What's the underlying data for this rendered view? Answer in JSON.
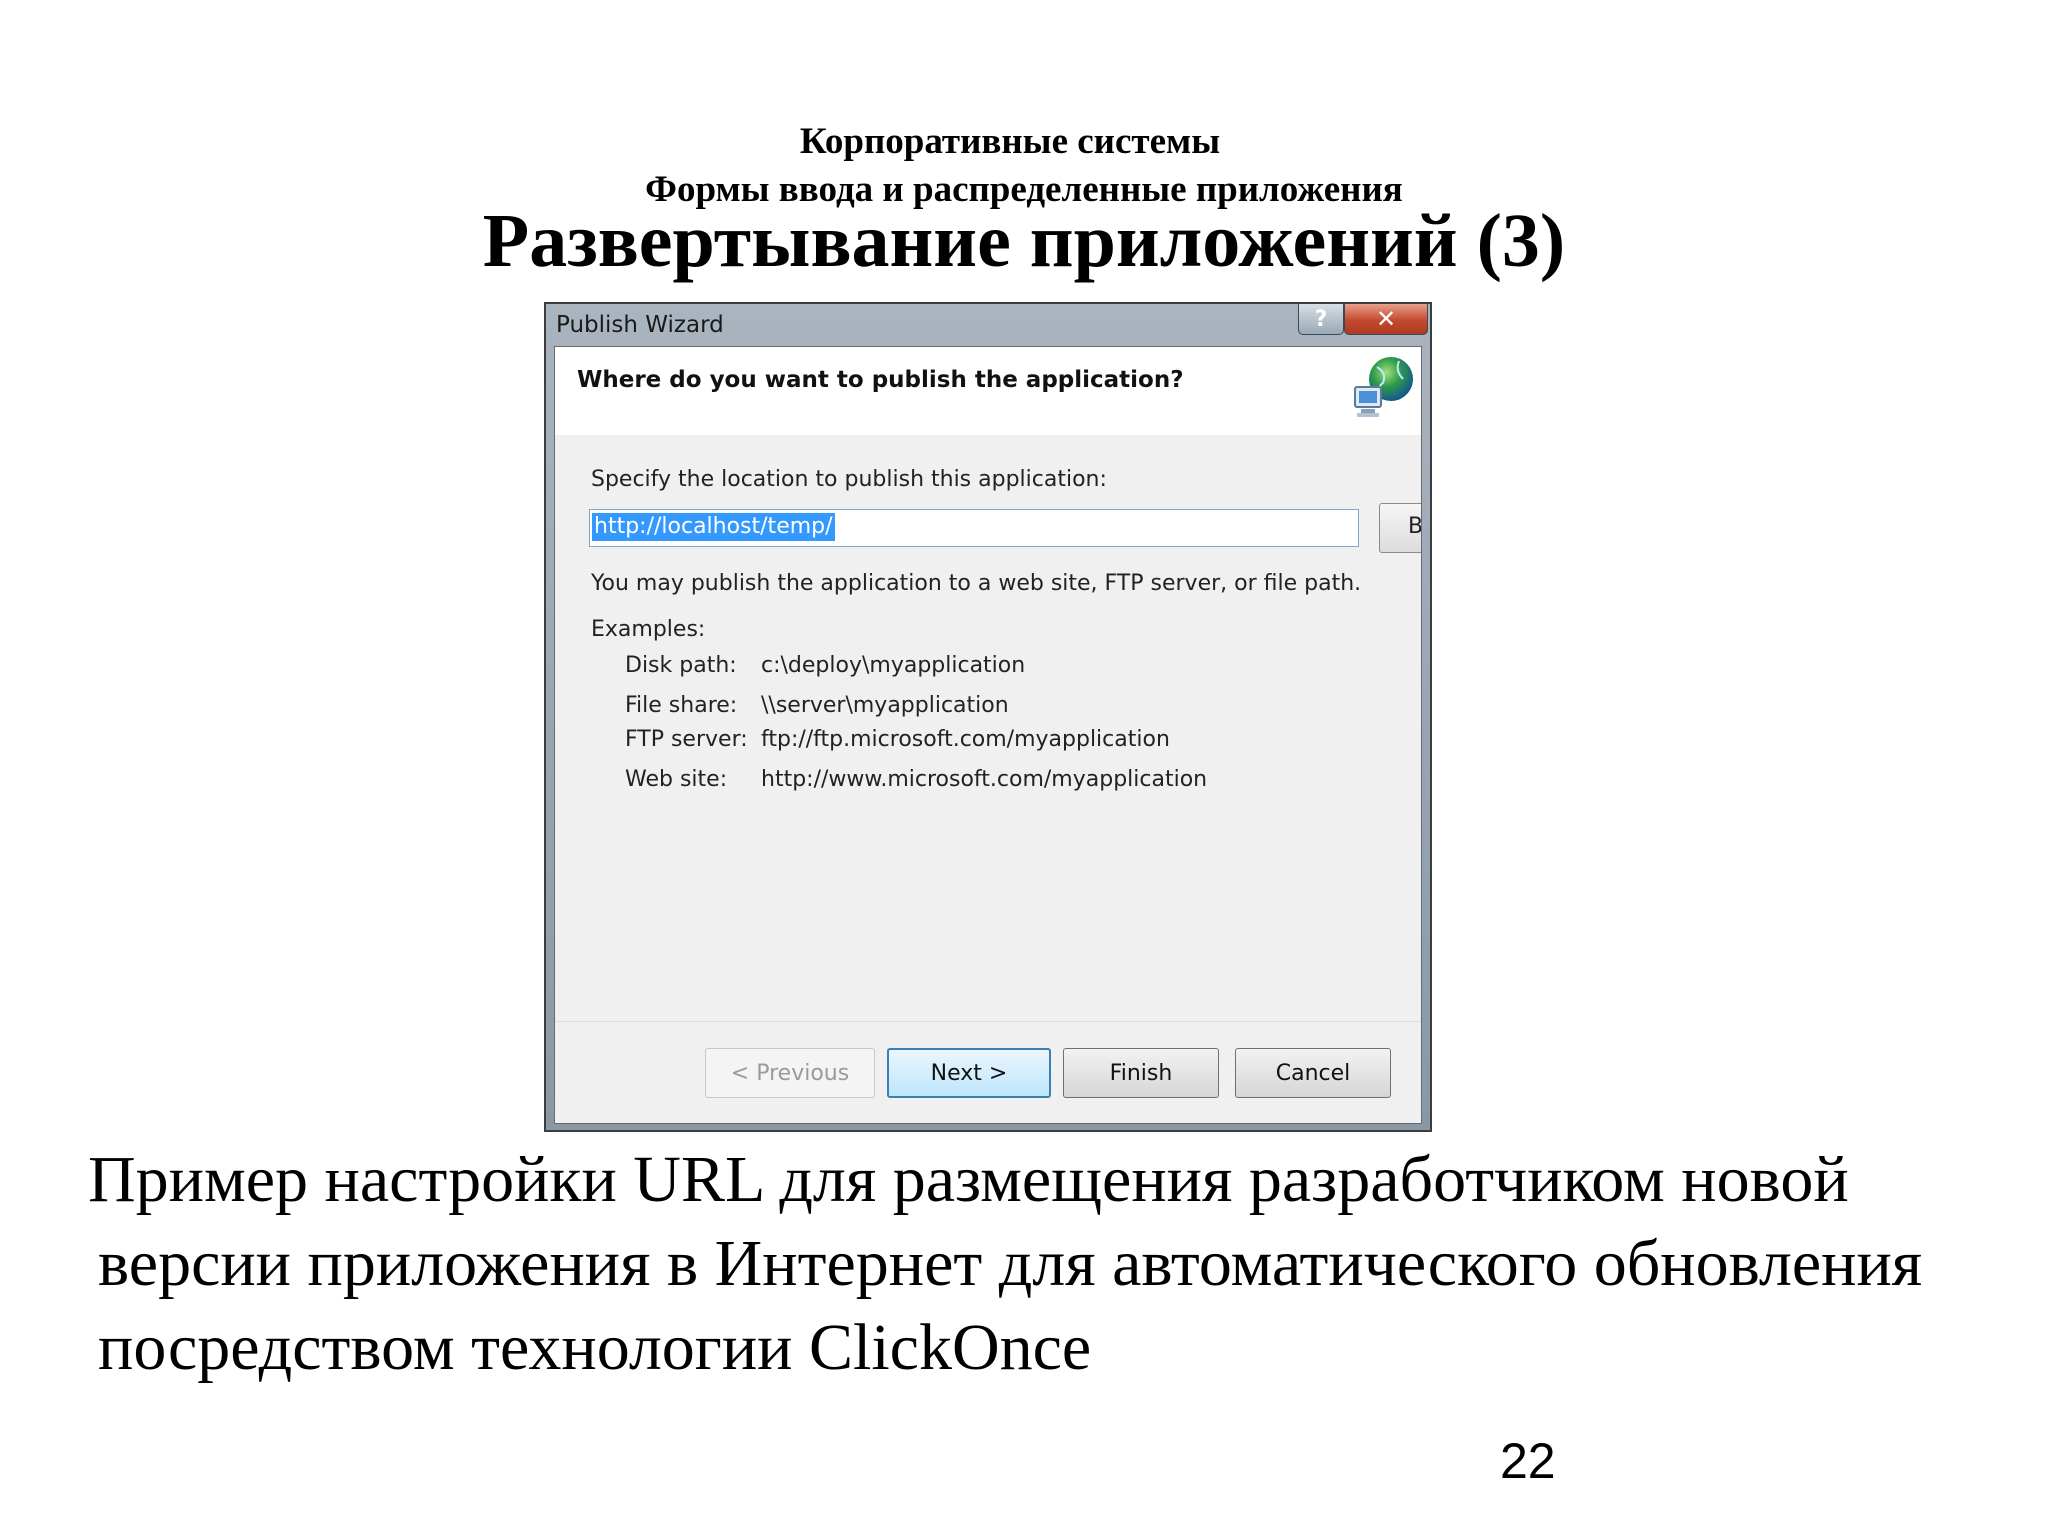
{
  "slide": {
    "header_line1": "Корпоративные системы",
    "header_line2": "Формы ввода и распределенные приложения",
    "title": "Развертывание приложений (3)",
    "caption_lines": [
      "Пример настройки URL для размещения разработчиком новой",
      "версии приложения в Интернет для автоматического обновления",
      "посредством технологии ClickOnce"
    ],
    "page_number": "22"
  },
  "dialog": {
    "title": "Publish Wizard",
    "help_button": "?",
    "close_button": "✕",
    "question": "Where do you want to publish the application?",
    "banner_icon": "globe-network-icon",
    "location_label": "Specify the location to publish this application:",
    "location_value": "http://localhost/temp/",
    "browse_label": "Browse...",
    "hint": "You may publish the application to a web site, FTP server, or file path.",
    "examples_label": "Examples:",
    "examples": [
      {
        "kind": "Disk path:",
        "value": "c:\\deploy\\myapplication"
      },
      {
        "kind": "File share:",
        "value": "\\\\server\\myapplication"
      },
      {
        "kind": "FTP server:",
        "value": "ftp://ftp.microsoft.com/myapplication"
      },
      {
        "kind": "Web site:",
        "value": "http://www.microsoft.com/myapplication"
      }
    ],
    "buttons": {
      "previous": "< Previous",
      "next": "Next >",
      "finish": "Finish",
      "cancel": "Cancel"
    }
  }
}
